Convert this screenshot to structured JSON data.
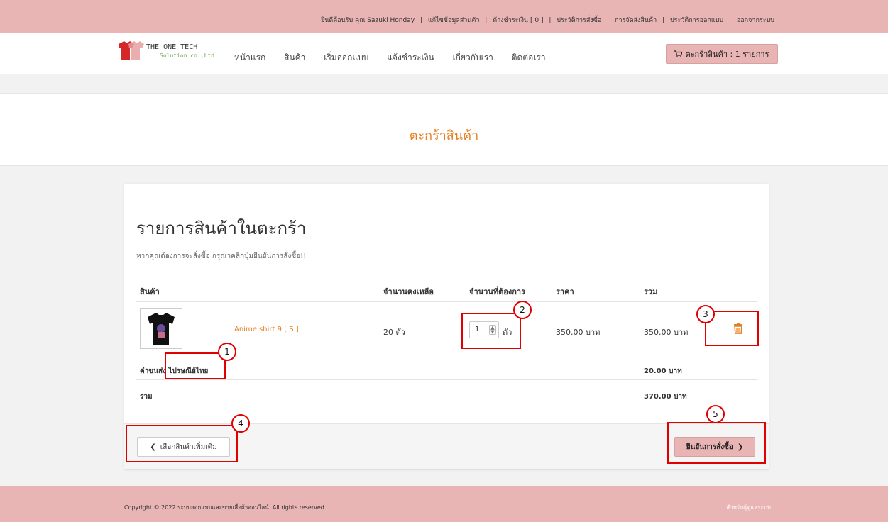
{
  "topbar": {
    "links": [
      "ยินดีต้อนรับ คุณ Sazuki Honday",
      "แก้ไขข้อมูลส่วนตัว",
      "ค้างชำระเงิน [ 0 ]",
      "ประวัติการสั่งซื้อ",
      "การจัดส่งสินค้า",
      "ประวัติการออกแบบ",
      "ออกจากระบบ"
    ],
    "separator": "|"
  },
  "logo": {
    "line1": "THE ONE TECH",
    "line2": "Solution co.,Ltd"
  },
  "nav": {
    "items": [
      "หน้าแรก",
      "สินค้า",
      "เริ่มออกแบบ",
      "แจ้งชำระเงิน",
      "เกี่ยวกับเรา",
      "ติดต่อเรา"
    ],
    "cart_label": "ตะกร้าสินค้า : 1 รายการ"
  },
  "hero": {
    "title": "ตะกร้าสินค้า"
  },
  "cart": {
    "title": "รายการสินค้าในตะกร้า",
    "subtitle": "หากคุณต้องการจะสั่งซื้อ กรุณาคลิกปุ่มยืนยันการสั่งซื้อ!!",
    "columns": [
      "สินค้า",
      "จำนวนคงเหลือ",
      "จำนวนที่ต้องการ",
      "ราคา",
      "รวม"
    ],
    "items": [
      {
        "name": "Anime shirt 9 [ S ]",
        "stock": "20 ตัว",
        "qty": "1",
        "qty_unit": "ตัว",
        "price": "350.00 บาท",
        "total": "350.00 บาท"
      }
    ],
    "shipping_label": "ค่าขนส่ง ไปรษณีย์ไทย",
    "shipping_value": "20.00 บาท",
    "sum_label": "รวม",
    "sum_value": "370.00 บาท",
    "more_button": "เลือกสินค้าเพิ่มเติม",
    "confirm_button": "ยืนยันการสั่งซื้อ"
  },
  "annotations": [
    "1",
    "2",
    "3",
    "4",
    "5"
  ],
  "footer": {
    "copyright": "Copyright © 2022 ระบบออกแบบและขายเสื้อผ้าออนไลน์. All rights reserved.",
    "admin_link": "สำหรับผู้ดูแลระบบ"
  },
  "colors": {
    "accent": "#e67e22",
    "brand_pink": "#e8b4b4",
    "annotation_red": "#e00000"
  }
}
